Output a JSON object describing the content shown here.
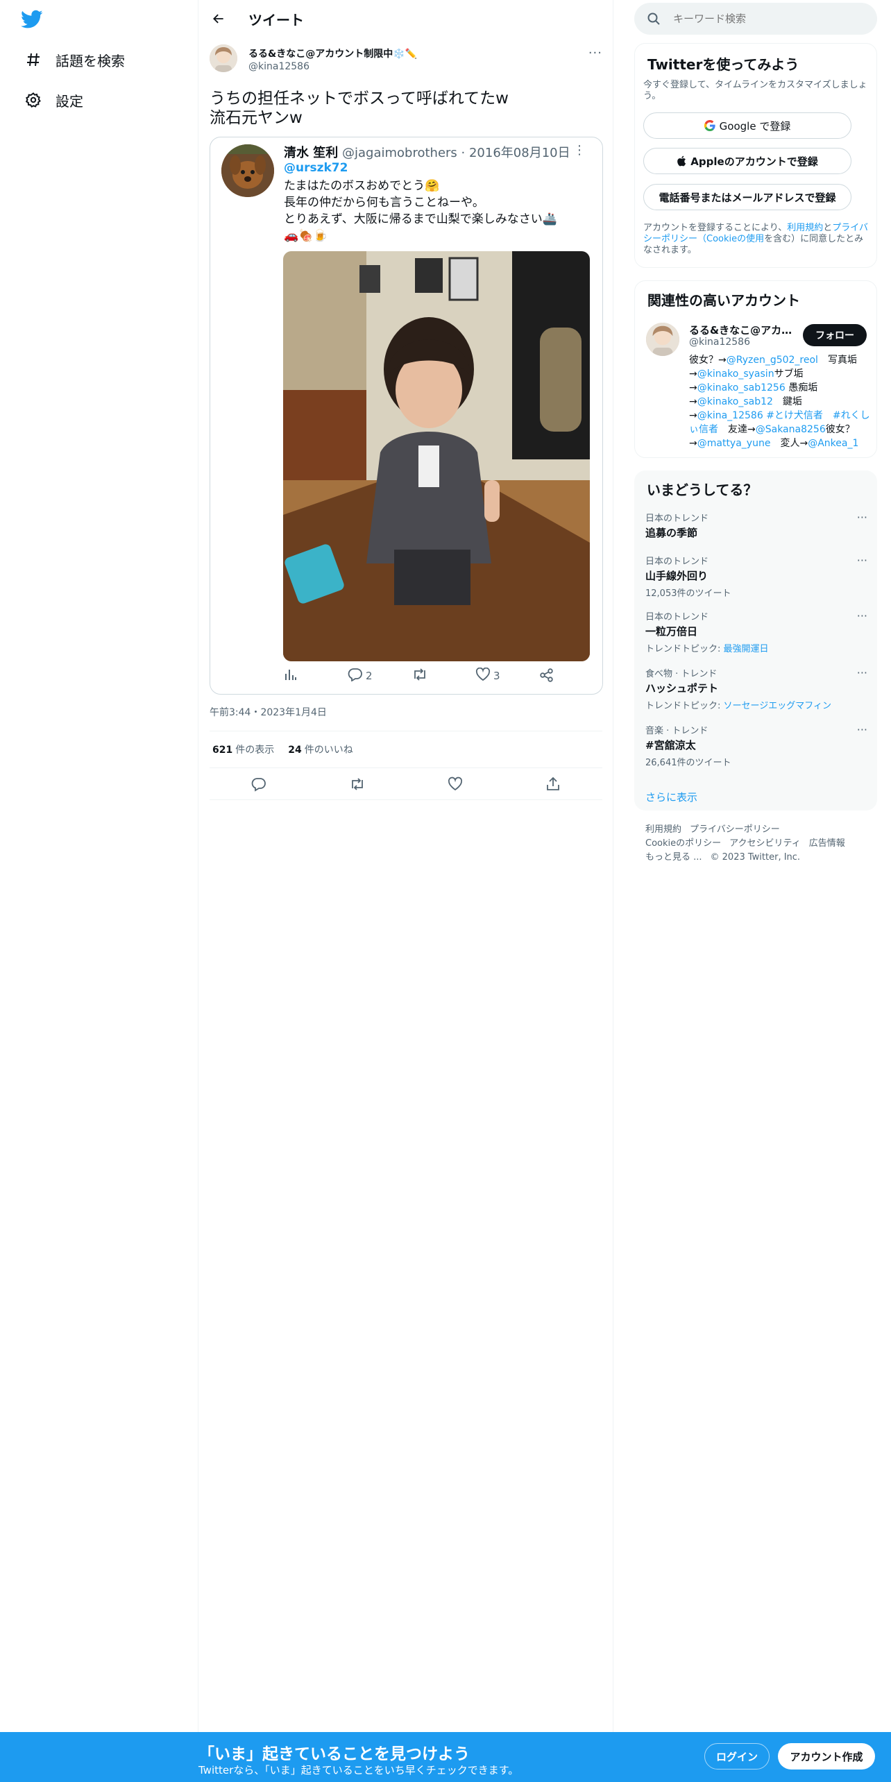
{
  "nav": {
    "explore_label": "話題を検索",
    "settings_label": "設定"
  },
  "header": {
    "title": "ツイート"
  },
  "tweet": {
    "author_name": "るる&きなこ@アカウント制限中❄️✏️",
    "author_handle": "@kina12586",
    "text_line1": "うちの担任ネットでボスって呼ばれてたw",
    "text_line2": "流石元ヤンw",
    "time": "午前3:44・2023年1月4日",
    "views_count": "621",
    "views_label": "件の表示",
    "likes_count": "24",
    "likes_label": "件のいいね"
  },
  "quote": {
    "name": "清水 笙利",
    "handle_date": "@jagaimobrothers · 2016年08月10日",
    "reply_to": "@urszk72",
    "body": "たまはたのボスおめでとう🤗\n長年の仲だから何も言うことねーや。\nとりあえず、大阪に帰るまで山梨で楽しみなさい🚢\n🚗🍖🍺",
    "replies": "2",
    "likes": "3"
  },
  "search": {
    "placeholder": "キーワード検索"
  },
  "signup_card": {
    "title": "Twitterを使ってみよう",
    "subtitle": "今すぐ登録して、タイムラインをカスタマイズしましょう。",
    "google_button": "Google で登録",
    "apple_button": "Appleのアカウントで登録",
    "phone_button": "電話番号またはメールアドレスで登録",
    "legal_prefix": "アカウントを登録することにより、",
    "legal_terms": "利用規約",
    "legal_and": "と",
    "legal_privacy": "プライバシーポリシー（Cookieの使用",
    "legal_suffix": "を含む）に同意したとみなされます。"
  },
  "related": {
    "title": "関連性の高いアカウント",
    "name": "るる&きなこ@アカ...",
    "handle": "@kina12586",
    "follow_label": "フォロー",
    "bio": [
      {
        "t": "彼女？→",
        "link": false
      },
      {
        "t": "@Ryzen_g502_reol",
        "link": true
      },
      {
        "t": "　写真垢→",
        "link": false
      },
      {
        "t": "@kinako_syasin",
        "link": true
      },
      {
        "t": "サブ垢→",
        "link": false
      },
      {
        "t": "@kinako_sab1256",
        "link": true
      },
      {
        "t": " 愚痴垢→",
        "link": false
      },
      {
        "t": "@kinako_sab12",
        "link": true
      },
      {
        "t": "　鍵垢→",
        "link": false
      },
      {
        "t": "@kina_12586",
        "link": true
      },
      {
        "t": " ",
        "link": false
      },
      {
        "t": "#とけ犬信者",
        "link": true
      },
      {
        "t": "　",
        "link": false
      },
      {
        "t": "#れくしぃ信者",
        "link": true
      },
      {
        "t": "　友達→",
        "link": false
      },
      {
        "t": "@Sakana8256",
        "link": true
      },
      {
        "t": "彼女？→",
        "link": false
      },
      {
        "t": "@mattya_yune",
        "link": true
      },
      {
        "t": "　変人→",
        "link": false
      },
      {
        "t": "@Ankea_1",
        "link": true
      }
    ]
  },
  "trends": {
    "title": "いまどうしてる？",
    "items": [
      {
        "category": "日本のトレンド",
        "name": "追募の季節",
        "meta": "",
        "topic": ""
      },
      {
        "category": "日本のトレンド",
        "name": "山手線外回り",
        "meta": "12,053件のツイート",
        "topic": ""
      },
      {
        "category": "日本のトレンド",
        "name": "一粒万倍日",
        "meta": "トレンドトピック: ",
        "topic": "最強開運日"
      },
      {
        "category": "食べ物 · トレンド",
        "name": "ハッシュポテト",
        "meta": "トレンドトピック: ",
        "topic": "ソーセージエッグマフィン"
      },
      {
        "category": "音楽 · トレンド",
        "name": "#宮舘涼太",
        "meta": "26,641件のツイート",
        "topic": ""
      }
    ],
    "show_more": "さらに表示"
  },
  "footer": {
    "terms": "利用規約",
    "privacy": "プライバシーポリシー",
    "cookie": "Cookieのポリシー",
    "accessibility": "アクセシビリティ",
    "ads": "広告情報",
    "more": "もっと見る ...",
    "copyright": "© 2023 Twitter, Inc."
  },
  "bottom_bar": {
    "title": "「いま」起きていることを見つけよう",
    "subtitle": "Twitterなら、「いま」起きていることをいち早くチェックできます。",
    "login": "ログイン",
    "signup": "アカウント作成"
  },
  "colors": {
    "brand": "#1d9bf0",
    "text": "#0f1419",
    "muted": "#536471"
  }
}
